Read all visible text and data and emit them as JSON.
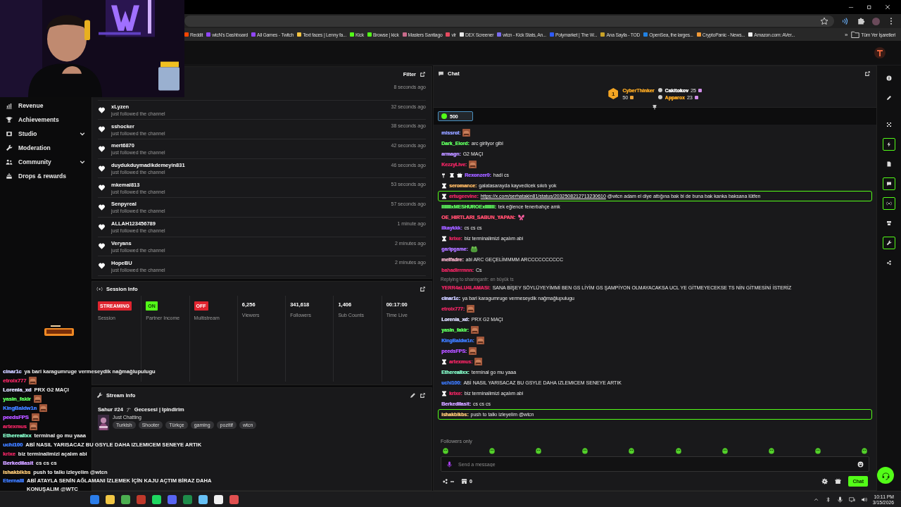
{
  "browser": {
    "bookmarks": [
      {
        "label": "Reddit",
        "color": "#ff4500"
      },
      {
        "label": "wtcN's Dashboard",
        "color": "#9146ff"
      },
      {
        "label": "All Games - Twitch",
        "color": "#9146ff"
      },
      {
        "label": "Text faces | Lenny fa...",
        "color": "#f5c542"
      },
      {
        "label": "Kick",
        "color": "#53fc18"
      },
      {
        "label": "Browse | kick",
        "color": "#53fc18"
      },
      {
        "label": "Masters Santiago",
        "color": "#c86b8a"
      },
      {
        "label": "vlr",
        "color": "#e84a5f"
      },
      {
        "label": "DEX Screener",
        "color": "#e8e8e8"
      },
      {
        "label": "wtcn - Kick Stats, An...",
        "color": "#7a6cf0"
      },
      {
        "label": "Polymarket | The W...",
        "color": "#2e5bff"
      },
      {
        "label": "Ana Sayfa - TOD",
        "color": "#c9a227"
      },
      {
        "label": "OpenSea, the larges...",
        "color": "#2081e2"
      },
      {
        "label": "CryptoPanic - News...",
        "color": "#f29b38"
      },
      {
        "label": "Amazon.com: AVer...",
        "color": "#f0f0f0"
      }
    ],
    "more": "»",
    "all_bookmarks": "Tüm Yer İşaretleri"
  },
  "sidebar": {
    "items": [
      {
        "label": "Revenue",
        "expandable": false
      },
      {
        "label": "Achievements",
        "expandable": false
      },
      {
        "label": "Studio",
        "expandable": true
      },
      {
        "label": "Moderation",
        "expandable": false
      },
      {
        "label": "Community",
        "expandable": true
      },
      {
        "label": "Drops & rewards",
        "expandable": false
      }
    ]
  },
  "followers": {
    "filter": "Filter",
    "rows": [
      {
        "time": "8 seconds ago"
      },
      {
        "name": "xLyzen",
        "action": "just followed the channel",
        "time": "32 seconds ago"
      },
      {
        "name": "sshocker",
        "action": "just followed the channel",
        "time": "38 seconds ago"
      },
      {
        "name": "mert6870",
        "action": "just followed the channel",
        "time": "42 seconds ago"
      },
      {
        "name": "duydukduymadikdemeyin831",
        "action": "just followed the channel",
        "time": "46 seconds ago"
      },
      {
        "name": "mkemal813",
        "action": "just followed the channel",
        "time": "53 seconds ago"
      },
      {
        "name": "Senpyreal",
        "action": "just followed the channel",
        "time": "57 seconds ago"
      },
      {
        "name": "ALLAH123456789",
        "action": "just followed the channel",
        "time": "1 minute ago"
      },
      {
        "name": "Veryans",
        "action": "just followed the channel",
        "time": "2 minutes ago"
      },
      {
        "name": "HopeBU",
        "action": "just followed the channel",
        "time": "2 minutes ago"
      }
    ]
  },
  "session_info": {
    "title": "Session Info",
    "cards": [
      {
        "kind": "badge",
        "value": "STREAMING",
        "color": "#e0242f",
        "label": "Session"
      },
      {
        "kind": "badge",
        "value": "ON",
        "color": "#53fc18",
        "label": "Partner Income"
      },
      {
        "kind": "badge",
        "value": "OFF",
        "color": "#e0242f",
        "label": "Multistream"
      },
      {
        "kind": "stat",
        "value": "6,256",
        "label": "Viewers"
      },
      {
        "kind": "stat",
        "value": "341,618",
        "label": "Followers"
      },
      {
        "kind": "stat",
        "value": "1,406",
        "label": "Sub Counts"
      },
      {
        "kind": "stat",
        "value": "00:17:00",
        "label": "Time Live"
      }
    ]
  },
  "stream_info": {
    "title": "Stream Info",
    "stream_title": [
      "Sahur #24",
      "Gecesesi | Ipindirim"
    ],
    "category": "Just Chatting",
    "tags": [
      "Turkish",
      "Shooter",
      "Türkçe",
      "gaming",
      "pozitif",
      "wtcn"
    ]
  },
  "chat": {
    "title": "Chat",
    "leaders": [
      {
        "rank": "1",
        "name": "CyberThinker",
        "count": "50",
        "color": "#f5a623"
      },
      {
        "name": "Cakitokov",
        "count": "25",
        "color": "#ffffff"
      },
      {
        "name": "Apparox",
        "count": "23",
        "color": "#f5a623"
      }
    ],
    "pinned_amount": "500",
    "messages": [
      {
        "kind": "message",
        "name": "missrol:",
        "color": "#8f9bff",
        "emote": {
          "kind": "face"
        },
        "highlighted": false
      },
      {
        "kind": "message",
        "name": "Dark_Elord:",
        "color": "#5cf55c",
        "text": "arc girliyor gibi",
        "highlighted": false
      },
      {
        "kind": "message",
        "name": "armagn:",
        "color": "#b58cff",
        "text": "G2 MAÇI",
        "highlighted": false
      },
      {
        "kind": "message",
        "name": "KezzyLive:",
        "color": "#e0245e",
        "emote": {
          "kind": "face"
        },
        "highlighted": false
      },
      {
        "kind": "message",
        "badges": [
          {
            "kind": "hammer"
          },
          {
            "kind": "ribbon"
          },
          {
            "kind": "gift"
          }
        ],
        "name": "Rexonzer0:",
        "color": "#9b5cff",
        "text": "hadi cs",
        "highlighted": false
      },
      {
        "kind": "message",
        "badges": [
          {
            "kind": "hourglass"
          }
        ],
        "name": "seromance:",
        "color": "#f0b060",
        "text": "galatasarayda kayvedicek sıkıtı yok",
        "highlighted": false
      },
      {
        "kind": "message",
        "badges": [
          {
            "kind": "hourglass"
          }
        ],
        "name": "ertugeevine:",
        "color": "#e0245e",
        "link": "https://x.com/serhatakin81/status/2032508212713230610",
        "text": "@wtcn adam el diye attığına bak bi de buna bak kanka baksana lütfen",
        "highlighted": true
      },
      {
        "kind": "message",
        "name": "IIIIIIIxMESHUROExIIIIIII:",
        "color": "#5cf55c",
        "text": "tek eğlence fenerbahçe amk",
        "highlighted": false
      },
      {
        "kind": "message",
        "name": "OE_HIRTLARI_SABUN_YAPAN:",
        "color": "#ff4d6d",
        "emote": {
          "kind": "butterfly"
        },
        "highlighted": false
      },
      {
        "kind": "message",
        "name": "ilkaykkk:",
        "color": "#9b5cff",
        "text": "cs cs cs",
        "highlighted": false
      },
      {
        "kind": "message",
        "badges": [
          {
            "kind": "hourglass"
          }
        ],
        "name": "krixe:",
        "color": "#e0245e",
        "text": "biz terminalimizi açalım abi",
        "highlighted": false
      },
      {
        "kind": "message",
        "name": "garipgame:",
        "color": "#a970ff",
        "emote": {
          "kind": "frog"
        },
        "highlighted": false
      },
      {
        "kind": "message",
        "name": "melfadre:",
        "color": "#f0b0c8",
        "text": "abi ARC GEÇELİMMMM ARCCCCCCCCCC",
        "highlighted": false
      },
      {
        "kind": "message",
        "name": "bahadirrrnnn:",
        "color": "#e0245e",
        "text": "Cs",
        "highlighted": false
      },
      {
        "kind": "reply",
        "text": "Replying to sharinganfr: en büyük ts"
      },
      {
        "kind": "message",
        "name": "YERR4aLU4LAMASI:",
        "color": "#e0245e",
        "text": "SANA BİŞEY SÖYLÜYEYİMMİ BEN GS LİYİM GS ŞAMPİYON OLMAYACAKSA UCL YE GİTMEYECEKSE TS NİN GİTMESİNİ İSTERİZ",
        "highlighted": false
      },
      {
        "kind": "message",
        "name": "cinar1c:",
        "color": "#c8c8ff",
        "text": "ya bari karagumruge vermeseydik nağmağlupulugu",
        "highlighted": false
      },
      {
        "kind": "message",
        "name": "etroix777:",
        "color": "#e0245e",
        "emote": {
          "kind": "face"
        },
        "highlighted": false
      },
      {
        "kind": "message",
        "name": "Lorenia_xd:",
        "color": "#dcdcff",
        "text": "PRX G2 MAÇI",
        "highlighted": false
      },
      {
        "kind": "message",
        "name": "yasin_fakir:",
        "color": "#5cf55c",
        "emote": {
          "kind": "face"
        },
        "highlighted": false
      },
      {
        "kind": "message",
        "name": "KingBaldw1n:",
        "color": "#3d7bff",
        "emote": {
          "kind": "face"
        },
        "highlighted": false
      },
      {
        "kind": "message",
        "name": "peedsFPS:",
        "color": "#b050ff",
        "emote": {
          "kind": "face"
        },
        "highlighted": false
      },
      {
        "kind": "message",
        "badges": [
          {
            "kind": "hourglass"
          }
        ],
        "name": "artexmus:",
        "color": "#e0245e",
        "emote": {
          "kind": "face"
        },
        "highlighted": false
      },
      {
        "kind": "message",
        "name": "Etherealixx:",
        "color": "#7ff0c0",
        "text": "terminal go mu yaaa",
        "highlighted": false
      },
      {
        "kind": "message",
        "name": "uchi100:",
        "color": "#3d7bff",
        "text": "ABİ NASIL YARISACAZ BU GSYLE DAHA IZLEMICEM SENEYE ARTIK",
        "highlighted": false
      },
      {
        "kind": "message",
        "badges": [
          {
            "kind": "hourglass"
          }
        ],
        "name": "krixe:",
        "color": "#e0245e",
        "text": "biz terminalimizi açalım abi",
        "highlighted": false
      },
      {
        "kind": "message",
        "name": "Berkedilasit:",
        "color": "#c89bff",
        "text": "cs cs cs",
        "highlighted": false
      },
      {
        "kind": "message",
        "name": "ishakbikbs:",
        "color": "#f0c070",
        "text": "push to talkı izleyelim @wtcn",
        "highlighted": true
      }
    ],
    "mode": "Followers only",
    "placeholder": "Send a message",
    "points": "∞",
    "store_count": "0",
    "send": "Chat"
  },
  "rail": [
    {
      "active": false
    },
    {
      "active": false
    },
    {
      "active": false
    },
    {
      "active": true
    },
    {
      "active": false
    },
    {
      "active": true
    },
    {
      "active": true
    },
    {
      "active": false
    },
    {
      "active": true
    },
    {
      "active": false
    }
  ],
  "overlay_chat": [
    {
      "name": "cinar1c",
      "color": "#c8c8ff",
      "text": "ya bari karagumruge vermeseydik nağmağlupulugu"
    },
    {
      "name": "etroix777",
      "color": "#e0245e",
      "emote": {
        "kind": "face"
      }
    },
    {
      "name": "Lorenia_xd",
      "color": "#dcdcff",
      "text": "PRX G2 MAÇI"
    },
    {
      "name": "yasin_fakir",
      "color": "#5cf55c",
      "emote": {
        "kind": "face"
      }
    },
    {
      "name": "KingBaldw1n",
      "color": "#3d7bff",
      "emote": {
        "kind": "face"
      }
    },
    {
      "name": "peedsFPS",
      "color": "#b050ff",
      "emote": {
        "kind": "face"
      }
    },
    {
      "name": "artexmus",
      "color": "#e0245e",
      "emote": {
        "kind": "face"
      }
    },
    {
      "name": "Etherealixx",
      "color": "#7ff0c0",
      "text": "terminal go mu yaaa"
    },
    {
      "name": "uchi100",
      "color": "#3d7bff",
      "text": "ABİ NASIL YARISACAZ BU GSYLE DAHA IZLEMICEM SENEYE ARTIK"
    },
    {
      "name": "krixe",
      "color": "#e0245e",
      "text": "biz terminalimizi açalım abi"
    },
    {
      "name": "Berkedilasit",
      "color": "#c89bff",
      "text": "cs cs cs"
    },
    {
      "name": "ishakbikbs",
      "color": "#f0c070",
      "text": "push to talkı izleyelim @wtcn"
    },
    {
      "name": "Eternalll",
      "color": "#3d7bff",
      "text": "ABİ ATAYLA SENİN AĞLAMANI İZLEMEK İÇİN KAJU AÇTIM BİRAZ DAHA KONUŞALIM @WTC"
    }
  ],
  "taskbar": {
    "apps": [
      {
        "color": "#2b7de9"
      },
      {
        "color": "#f2c744"
      },
      {
        "color": "#4caf50"
      },
      {
        "color": "#c0392b"
      },
      {
        "color": "#1ed760"
      },
      {
        "color": "#5865f2"
      },
      {
        "color": "#1e8c4a"
      },
      {
        "color": "#66c0f4"
      },
      {
        "color": "#f0f0f0"
      },
      {
        "color": "#e05050"
      }
    ],
    "time": "10:11 PM",
    "date": "3/15/2026"
  }
}
